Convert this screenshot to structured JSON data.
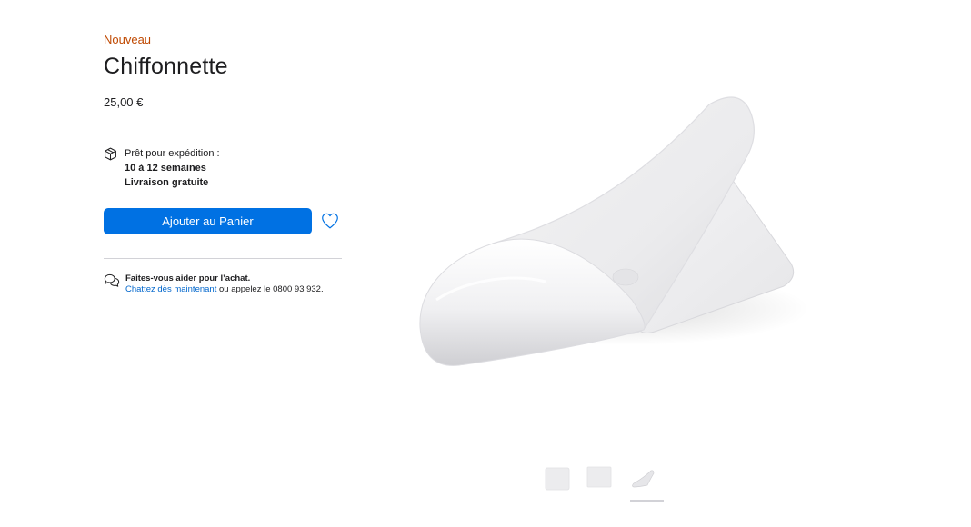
{
  "product": {
    "badge": "Nouveau",
    "title": "Chiffonnette",
    "price": "25,00 €"
  },
  "shipping": {
    "icon": "box-icon",
    "label": "Prêt pour expédition :",
    "delay": "10 à 12 semaines",
    "delivery": "Livraison gratuite"
  },
  "actions": {
    "add_to_cart_label": "Ajouter au Panier",
    "wishlist_icon": "heart-icon",
    "accent_color": "#0071e3"
  },
  "help": {
    "icon": "chat-bubbles-icon",
    "title": "Faites-vous aider pour l’achat.",
    "chat_link": "Chattez dès maintenant",
    "phone_text": " ou appelez le 0800 93 932."
  },
  "gallery": {
    "thumbnails": [
      {
        "name": "thumbnail-1",
        "selected": false
      },
      {
        "name": "thumbnail-2",
        "selected": false
      },
      {
        "name": "thumbnail-3",
        "selected": true
      }
    ]
  }
}
